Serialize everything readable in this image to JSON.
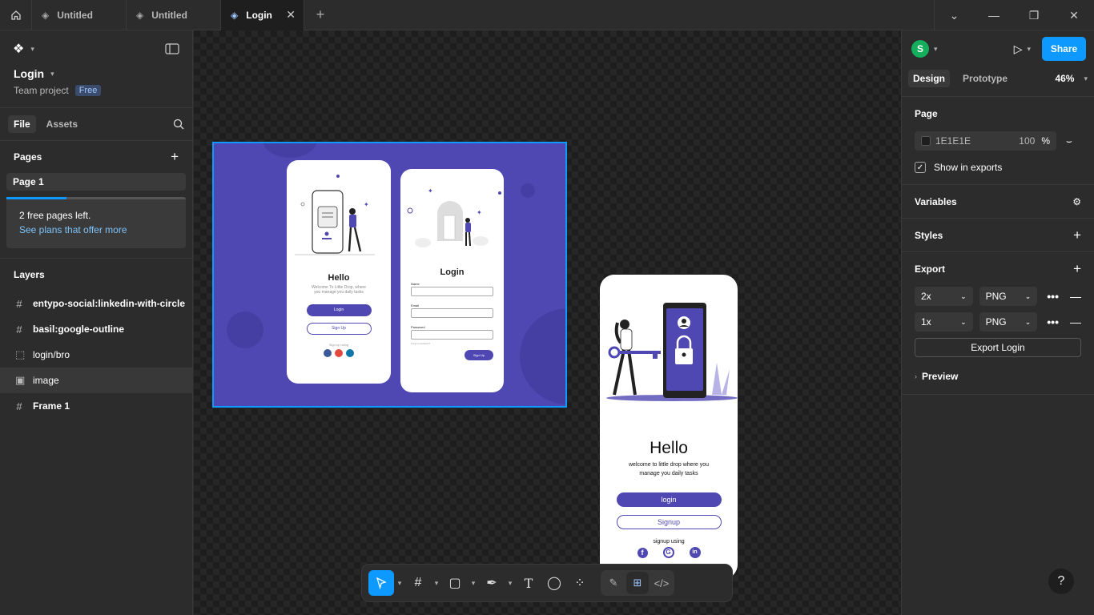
{
  "tabs": [
    {
      "label": "Untitled"
    },
    {
      "label": "Untitled"
    },
    {
      "label": "Login"
    }
  ],
  "left": {
    "project_name": "Login",
    "project_sub": "Team project",
    "plan_badge": "Free",
    "file_tab": "File",
    "assets_tab": "Assets",
    "pages_title": "Pages",
    "page_item": "Page 1",
    "free_pages_text": "2 free pages left.",
    "plans_link": "See plans that offer more",
    "layers_title": "Layers",
    "layers": [
      {
        "icon": "#",
        "label": "entypo-social:linkedin-with-circle"
      },
      {
        "icon": "#",
        "label": "basil:google-outline"
      },
      {
        "icon": "⬚",
        "label": "login/bro"
      },
      {
        "icon": "▣",
        "label": "image"
      },
      {
        "icon": "#",
        "label": "Frame 1"
      }
    ]
  },
  "right": {
    "avatar_letter": "S",
    "share_label": "Share",
    "design_tab": "Design",
    "prototype_tab": "Prototype",
    "zoom": "46%",
    "page_title": "Page",
    "page_color": "1E1E1E",
    "page_opacity": "100",
    "percent": "%",
    "show_exports": "Show in exports",
    "variables_title": "Variables",
    "styles_title": "Styles",
    "export_title": "Export",
    "export_rows": [
      {
        "scale": "2x",
        "format": "PNG"
      },
      {
        "scale": "1x",
        "format": "PNG"
      }
    ],
    "export_button": "Export Login",
    "preview_title": "Preview"
  },
  "canvas": {
    "mock1_hello": "Hello",
    "mock1_sub1": "Welcome To Little Drop, where",
    "mock1_sub2": "you manage you daily tasks",
    "mock1_login": "Login",
    "mock1_signup": "Sign Up",
    "mock1_signup_using": "Sign up using",
    "mock2_title": "Login",
    "mock2_name": "Name",
    "mock2_email": "Email",
    "mock2_password": "Password",
    "mock2_forgot": "Forgot password?",
    "mock2_signup": "Sign Up",
    "frame_hello": "Hello",
    "frame_sub1": "welcome to little drop where you",
    "frame_sub2": "manage you daily tasks",
    "frame_login": "login",
    "frame_signup": "Signup",
    "frame_signup_using": "signup using",
    "brand_purple": "#4f48b3",
    "selection_blue": "#0d99ff"
  },
  "help_label": "?"
}
